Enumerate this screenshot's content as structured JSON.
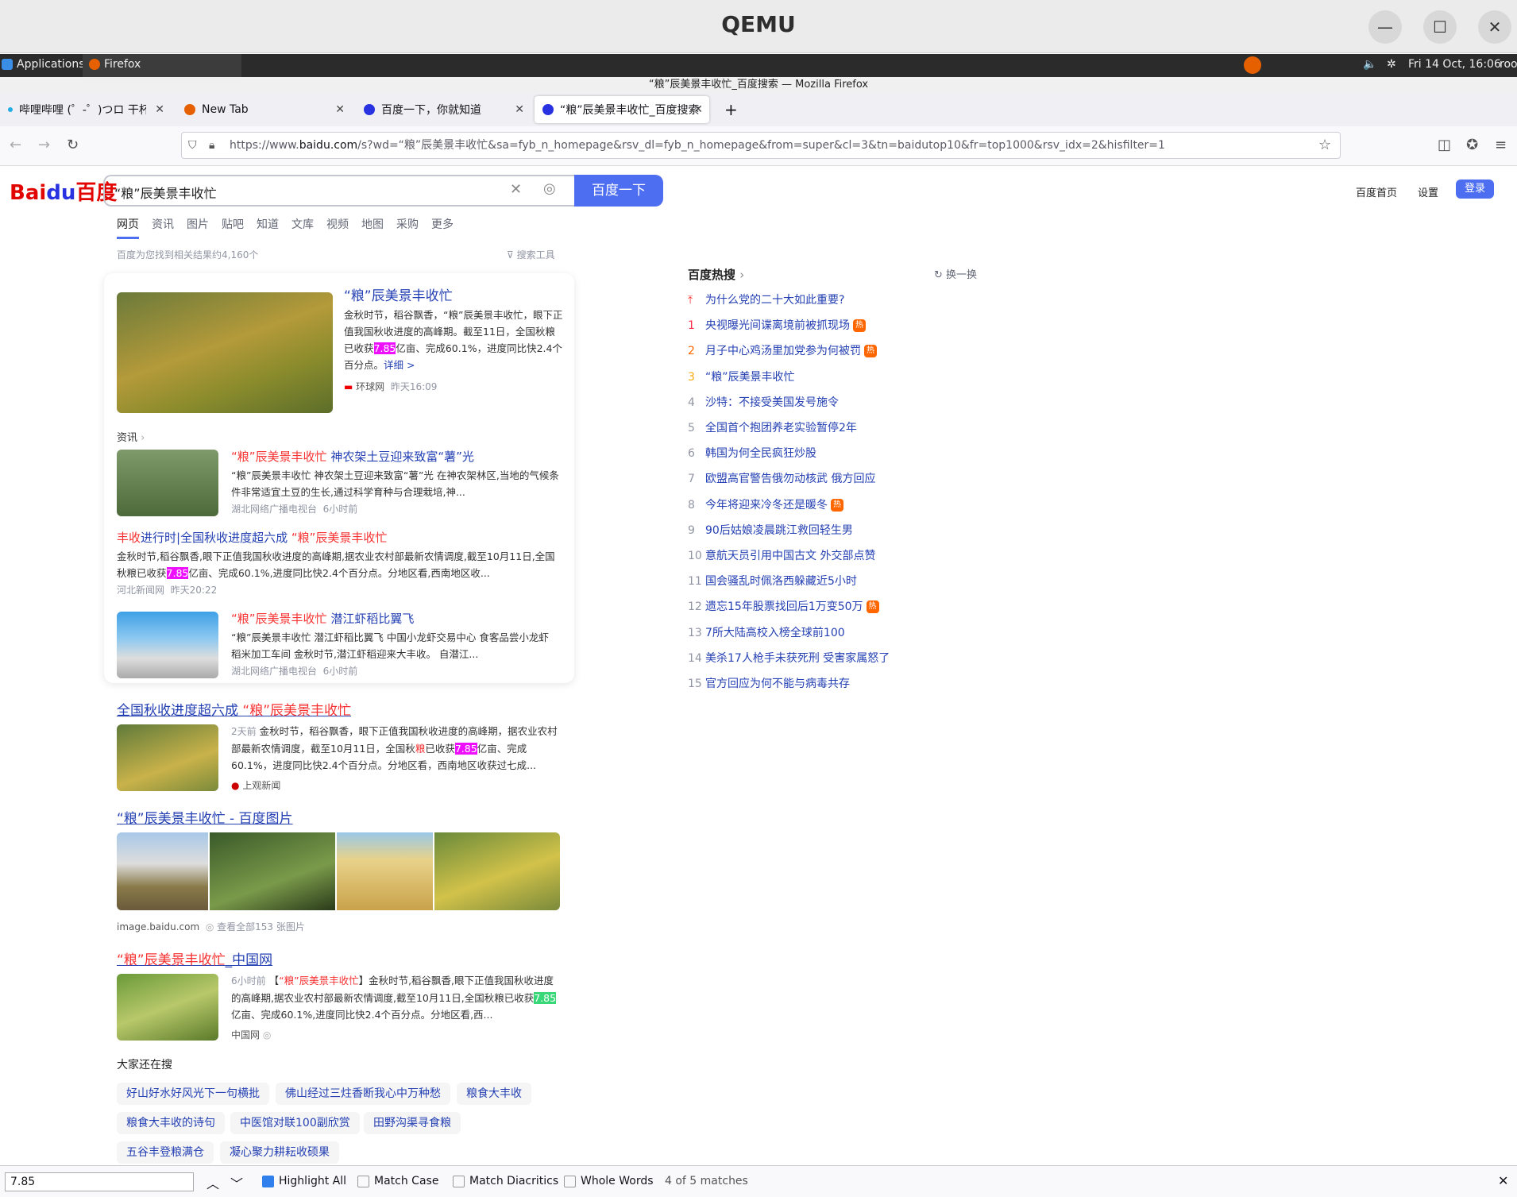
{
  "qemu": {
    "title": "QEMU"
  },
  "panel": {
    "applications": "Applications",
    "firefox": "Firefox",
    "clock": "Fri 14 Oct, 16:06",
    "user": "roo"
  },
  "window_title": "“粮”辰美景丰收忙_百度搜索 — Mozilla Firefox",
  "tabs": [
    {
      "label": "哔哩哔哩 (゜-゜)つロ 干杯~"
    },
    {
      "label": "New Tab"
    },
    {
      "label": "百度一下，你就知道"
    },
    {
      "label": "“粮”辰美景丰收忙_百度搜索"
    }
  ],
  "url": {
    "prefix": "https://www.",
    "domain": "baidu.com",
    "rest": "/s?wd=“粮”辰美景丰收忙&sa=fyb_n_homepage&rsv_dl=fyb_n_homepage&from=super&cl=3&tn=baidutop10&fr=top1000&rsv_idx=2&hisfilter=1"
  },
  "search": {
    "logo_bai": "Bai",
    "logo_du": "du",
    "logo_cn": "百度",
    "query": "“粮”辰美景丰收忙",
    "button": "百度一下"
  },
  "topright": {
    "home": "百度首页",
    "settings": "设置",
    "login": "登录"
  },
  "nav_tabs": [
    "网页",
    "资讯",
    "图片",
    "贴吧",
    "知道",
    "文库",
    "视频",
    "地图",
    "采购",
    "更多"
  ],
  "result_count": "百度为您找到相关结果约4,160个",
  "search_tools": "搜索工具",
  "top_card": {
    "title": "“粮”辰美景丰收忙",
    "snippet_a": "金秋时节，稻谷飘香，“粮”辰美景丰收忙，眼下正值我国秋收进度的高峰期。截至11日，全国秋粮已收获",
    "snippet_hl": "7.85",
    "snippet_b": "亿亩、完成60.1%，进度同比快2.4个百分点。",
    "more": "详细 >",
    "source": "环球网",
    "time": "昨天16:09"
  },
  "news_label": "资讯",
  "news": [
    {
      "title_red": "“粮”辰美景丰收忙",
      "title_rest": " 神农架土豆迎来致富“薯”光",
      "snippet": "“粮”辰美景丰收忙 神农架土豆迎来致富“薯”光 在神农架林区,当地的气候条件非常适宜土豆的生长,通过科学育种与合理栽培,神...",
      "source": "湖北网络广播电视台",
      "time": "6小时前"
    },
    {
      "title_a": "丰收",
      "title_b": "进行时|全国秋收进度超六成 ",
      "title_c": "“粮”辰美景丰收忙",
      "snippet_a": "金秋时节,稻谷飘香,眼下正值我国秋收进度的高峰期,据农业农村部最新农情调度,截至10月11日,全国秋粮已收获",
      "snippet_hl": "7.85",
      "snippet_b": "亿亩、完成60.1%,进度同比快2.4个百分点。分地区看,西南地区收...",
      "source": "河北新闻网",
      "time": "昨天20:22"
    },
    {
      "title_red": "“粮”辰美景丰收忙",
      "title_rest": " 潜江虾稻比翼飞",
      "snippet": "“粮”辰美景丰收忙 潜江虾稻比翼飞 中国小龙虾交易中心 食客品尝小龙虾 稻米加工车间 金秋时节,潜江虾稻迎来大丰收。 自潜江...",
      "source": "湖北网络广播电视台",
      "time": "6小时前"
    }
  ],
  "result1": {
    "title_a": "全国秋收进度超六成 ",
    "title_b": "“粮”辰美景丰收忙",
    "date": "2天前",
    "snippet_a": " 金秋时节，稻谷飘香，眼下正值我国秋收进度的高峰期，据农业农村部最新农情调度，截至10月11日，全国秋",
    "snippet_red": "粮",
    "snippet_b": "已收获",
    "snippet_hl": "7.85",
    "snippet_c": "亿亩、完成60.1%，进度同比快2.4个百分点。分地区看，西南地区收获过七成...",
    "source": "上观新闻"
  },
  "result2": {
    "title": "“粮”辰美景丰收忙 - 百度图片",
    "source": "image.baidu.com",
    "more": "查看全部153 张图片"
  },
  "result3": {
    "title_a": "“粮”辰美景丰收忙",
    "title_b": "_中国网",
    "date": "6小时前",
    "snippet_a": " 【",
    "snippet_red": "“粮”辰美景丰收忙",
    "snippet_b": "】金秋时节,稻谷飘香,眼下正值我国秋收进度的高峰期,据农业农村部最新农情调度,截至10月11日,全国秋粮已收获",
    "snippet_hl": "7.85",
    "snippet_c": "亿亩、完成60.1%,进度同比快2.4个百分点。分地区看,西...",
    "source": "中国网"
  },
  "related_title": "大家还在搜",
  "related": [
    "好山好水好风光下一句横批",
    "佛山经过三炷香断我心中万种愁",
    "粮食大丰收",
    "粮食大丰收的诗句",
    "中医馆对联100副欣赏",
    "田野沟渠寻食粮",
    "五谷丰登粮满仓",
    "凝心聚力耕耘收硕果"
  ],
  "hot": {
    "title": "百度热搜",
    "refresh": "换一换",
    "items": [
      {
        "n": "",
        "text": "为什么党的二十大如此重要?"
      },
      {
        "n": "1",
        "text": "央视曝光间谍离境前被抓现场",
        "badge": "热"
      },
      {
        "n": "2",
        "text": "月子中心鸡汤里加党参为何被罚",
        "badge": "热"
      },
      {
        "n": "3",
        "text": "“粮”辰美景丰收忙"
      },
      {
        "n": "4",
        "text": "沙特：不接受美国发号施令"
      },
      {
        "n": "5",
        "text": "全国首个抱团养老实验暂停2年"
      },
      {
        "n": "6",
        "text": "韩国为何全民疯狂炒股"
      },
      {
        "n": "7",
        "text": "欧盟高官警告俄勿动核武 俄方回应"
      },
      {
        "n": "8",
        "text": "今年将迎来冷冬还是暖冬",
        "badge": "热"
      },
      {
        "n": "9",
        "text": "90后姑娘凌晨跳江救回轻生男"
      },
      {
        "n": "10",
        "text": "意航天员引用中国古文 外交部点赞"
      },
      {
        "n": "11",
        "text": "国会骚乱时佩洛西躲藏近5小时"
      },
      {
        "n": "12",
        "text": "遗忘15年股票找回后1万变50万",
        "badge": "热"
      },
      {
        "n": "13",
        "text": "7所大陆高校入榜全球前100"
      },
      {
        "n": "14",
        "text": "美杀17人枪手未获死刑 受害家属怒了"
      },
      {
        "n": "15",
        "text": "官方回应为何不能与病毒共存"
      }
    ]
  },
  "findbar": {
    "query": "7.85",
    "highlight_all": "Highlight All",
    "match_case": "Match Case",
    "match_diacritics": "Match Diacritics",
    "whole_words": "Whole Words",
    "status": "4 of 5 matches"
  }
}
